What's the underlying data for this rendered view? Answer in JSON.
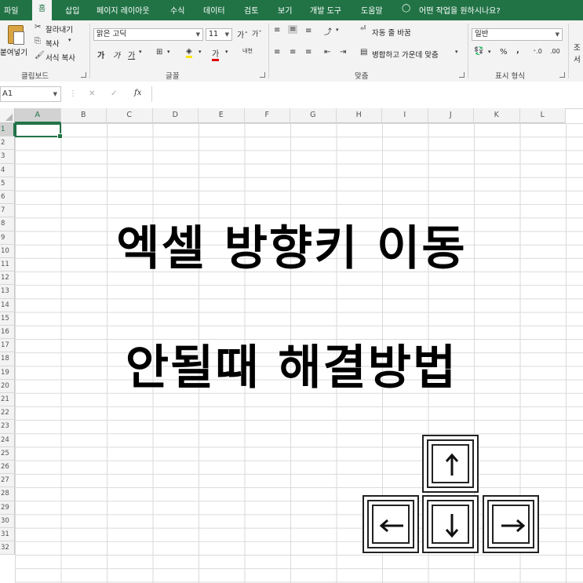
{
  "tabs": [
    "파일",
    "홈",
    "삽입",
    "페이지 레이아웃",
    "수식",
    "데이터",
    "검토",
    "보기",
    "개발 도구",
    "도움말",
    "어떤 작업을 원하시나요?"
  ],
  "ribbon": {
    "clipboard": {
      "paste": "붙여넣기",
      "cut": "잘라내기",
      "copy": "복사",
      "format_painter": "서식 복사",
      "group": "클립보드"
    },
    "font": {
      "name": "맑은 고딕",
      "size": "11",
      "group": "글꼴"
    },
    "align": {
      "wrap": "자동 줄 바꿈",
      "merge": "병합하고 가운데 맞춤",
      "group": "맞춤"
    },
    "number": {
      "format": "일반",
      "group": "표시 형식"
    },
    "cut_right": "조",
    "cut_right2": "서"
  },
  "formula_bar": {
    "name_box": "A1",
    "fx": "fx"
  },
  "columns": [
    "A",
    "B",
    "C",
    "D",
    "E",
    "F",
    "G",
    "H",
    "I",
    "J",
    "K",
    "L"
  ],
  "rows": [
    "1",
    "2",
    "3",
    "4",
    "5",
    "6",
    "7",
    "8",
    "9",
    "10",
    "11",
    "12",
    "13",
    "14",
    "15",
    "16",
    "17",
    "18",
    "19",
    "20",
    "21",
    "22",
    "23",
    "24",
    "25",
    "26",
    "27",
    "28",
    "29",
    "30",
    "31",
    "32"
  ],
  "overlay": {
    "line1": "엑셀 방향키 이동",
    "line2": "안될때 해결방법"
  },
  "keys": [
    "up-arrow",
    "left-arrow",
    "down-arrow",
    "right-arrow"
  ],
  "colors": {
    "excel_green": "#217346",
    "selection": "#217346"
  }
}
